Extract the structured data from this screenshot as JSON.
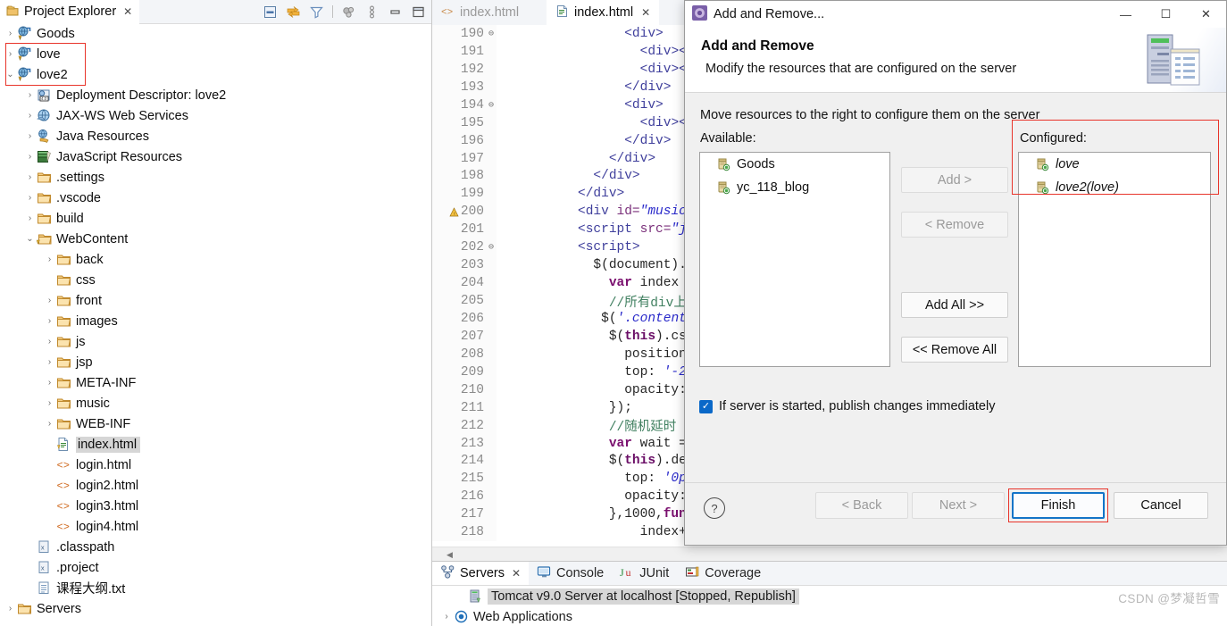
{
  "explorer": {
    "tab_title": "Project Explorer",
    "tab_close": "✕",
    "toolbar": [
      "collapse-all-icon",
      "link-with-editor-icon",
      "filter-icon",
      "view-menu-icon",
      "more-icon",
      "minimize-icon",
      "maximize-icon"
    ],
    "tree": [
      {
        "label": "Goods",
        "depth": 0,
        "twist": "›",
        "icon": "dynamic-web-project-icon"
      },
      {
        "label": "love",
        "depth": 0,
        "twist": "›",
        "icon": "dynamic-web-project-icon"
      },
      {
        "label": "love2",
        "depth": 0,
        "twist": "⌄",
        "icon": "dynamic-web-project-icon"
      },
      {
        "label": "Deployment Descriptor: love2",
        "depth": 1,
        "twist": "›",
        "icon": "deployment-descriptor-icon"
      },
      {
        "label": "JAX-WS Web Services",
        "depth": 1,
        "twist": "›",
        "icon": "jaxws-icon"
      },
      {
        "label": "Java Resources",
        "depth": 1,
        "twist": "›",
        "icon": "java-resources-icon"
      },
      {
        "label": "JavaScript Resources",
        "depth": 1,
        "twist": "›",
        "icon": "javascript-resources-icon"
      },
      {
        "label": ".settings",
        "depth": 1,
        "twist": "›",
        "icon": "folder-icon"
      },
      {
        "label": ".vscode",
        "depth": 1,
        "twist": "›",
        "icon": "folder-icon"
      },
      {
        "label": "build",
        "depth": 1,
        "twist": "›",
        "icon": "folder-icon"
      },
      {
        "label": "WebContent",
        "depth": 1,
        "twist": "⌄",
        "icon": "webcontent-folder-icon"
      },
      {
        "label": "back",
        "depth": 2,
        "twist": "›",
        "icon": "folder-icon"
      },
      {
        "label": "css",
        "depth": 2,
        "twist": "",
        "icon": "folder-icon"
      },
      {
        "label": "front",
        "depth": 2,
        "twist": "›",
        "icon": "folder-icon"
      },
      {
        "label": "images",
        "depth": 2,
        "twist": "›",
        "icon": "folder-icon"
      },
      {
        "label": "js",
        "depth": 2,
        "twist": "›",
        "icon": "folder-icon"
      },
      {
        "label": "jsp",
        "depth": 2,
        "twist": "›",
        "icon": "folder-icon"
      },
      {
        "label": "META-INF",
        "depth": 2,
        "twist": "›",
        "icon": "folder-icon"
      },
      {
        "label": "music",
        "depth": 2,
        "twist": "›",
        "icon": "folder-icon"
      },
      {
        "label": "WEB-INF",
        "depth": 2,
        "twist": "›",
        "icon": "folder-icon"
      },
      {
        "label": "index.html",
        "depth": 2,
        "twist": "",
        "icon": "html-warning-icon",
        "selected": true
      },
      {
        "label": "login.html",
        "depth": 2,
        "twist": "",
        "icon": "html-icon"
      },
      {
        "label": "login2.html",
        "depth": 2,
        "twist": "",
        "icon": "html-icon"
      },
      {
        "label": "login3.html",
        "depth": 2,
        "twist": "",
        "icon": "html-icon"
      },
      {
        "label": "login4.html",
        "depth": 2,
        "twist": "",
        "icon": "html-icon"
      },
      {
        "label": ".classpath",
        "depth": 1,
        "twist": "",
        "icon": "xml-file-icon"
      },
      {
        "label": ".project",
        "depth": 1,
        "twist": "",
        "icon": "xml-file-icon"
      },
      {
        "label": "课程大纲.txt",
        "depth": 1,
        "twist": "",
        "icon": "text-file-icon"
      },
      {
        "label": "Servers",
        "depth": 0,
        "twist": "›",
        "icon": "folder-icon"
      }
    ]
  },
  "editor": {
    "tabs": [
      {
        "label": "index.html",
        "icon": "code-icon",
        "active": false
      },
      {
        "label": "index.html",
        "icon": "html-file-icon",
        "active": true,
        "close": "✕"
      }
    ],
    "lines": [
      {
        "n": "190",
        "fold": "⊖",
        "warn": false,
        "html": "                <span class='tg'>&lt;div&gt;</span>"
      },
      {
        "n": "191",
        "fold": "",
        "warn": false,
        "html": "                  <span class='tg'>&lt;div&gt;&lt;</span>"
      },
      {
        "n": "192",
        "fold": "",
        "warn": false,
        "html": "                  <span class='tg'>&lt;div&gt;&lt;</span>"
      },
      {
        "n": "193",
        "fold": "",
        "warn": false,
        "html": "                <span class='tg'>&lt;/div&gt;</span>"
      },
      {
        "n": "194",
        "fold": "⊖",
        "warn": false,
        "html": "                <span class='tg'>&lt;div&gt;</span>"
      },
      {
        "n": "195",
        "fold": "",
        "warn": false,
        "html": "                  <span class='tg'>&lt;div&gt;&lt;</span>"
      },
      {
        "n": "196",
        "fold": "",
        "warn": false,
        "html": "                <span class='tg'>&lt;/div&gt;</span>"
      },
      {
        "n": "197",
        "fold": "",
        "warn": false,
        "html": "              <span class='tg'>&lt;/div&gt;</span>"
      },
      {
        "n": "198",
        "fold": "",
        "warn": false,
        "html": "            <span class='tg'>&lt;/div&gt;</span>"
      },
      {
        "n": "199",
        "fold": "",
        "warn": false,
        "html": "          <span class='tg'>&lt;/div&gt;</span>"
      },
      {
        "n": "200",
        "fold": "",
        "warn": true,
        "html": "          <span class='tg'>&lt;div</span> <span class='at'>id=</span><span class='st'>\"music\"</span><span class='tg'>&gt;&lt;a</span>"
      },
      {
        "n": "201",
        "fold": "",
        "warn": false,
        "html": "          <span class='tg'>&lt;script</span> <span class='at'>src=</span><span class='st'>\"js/jq</span>"
      },
      {
        "n": "202",
        "fold": "⊖",
        "warn": false,
        "html": "          <span class='tg'>&lt;script&gt;</span>"
      },
      {
        "n": "203",
        "fold": "",
        "warn": false,
        "html": "            $(document).re"
      },
      {
        "n": "204",
        "fold": "",
        "warn": false,
        "html": "              <span class='kw'>var</span> index"
      },
      {
        "n": "205",
        "fold": "",
        "warn": false,
        "html": "              <span class='cm'>//所有div上</span>"
      },
      {
        "n": "206",
        "fold": "",
        "warn": false,
        "html": "             $(<span class='st'>'.content</span>"
      },
      {
        "n": "207",
        "fold": "",
        "warn": false,
        "html": "              $(<span class='fn'>this</span>).cs"
      },
      {
        "n": "208",
        "fold": "",
        "warn": false,
        "html": "                position"
      },
      {
        "n": "209",
        "fold": "",
        "warn": false,
        "html": "                top: <span class='st'>'-2</span>"
      },
      {
        "n": "210",
        "fold": "",
        "warn": false,
        "html": "                opacity:"
      },
      {
        "n": "211",
        "fold": "",
        "warn": false,
        "html": "              });"
      },
      {
        "n": "212",
        "fold": "",
        "warn": false,
        "html": "              <span class='cm'>//随机延时</span>"
      },
      {
        "n": "213",
        "fold": "",
        "warn": false,
        "html": "              <span class='kw'>var</span> wait ="
      },
      {
        "n": "214",
        "fold": "",
        "warn": false,
        "html": "              $(<span class='fn'>this</span>).de"
      },
      {
        "n": "215",
        "fold": "",
        "warn": false,
        "html": "                top: <span class='st'>'0p</span>"
      },
      {
        "n": "216",
        "fold": "",
        "warn": false,
        "html": "                opacity:"
      },
      {
        "n": "217",
        "fold": "",
        "warn": false,
        "html": "              },1000,<span class='kw'>fun</span>"
      },
      {
        "n": "218",
        "fold": "",
        "warn": false,
        "html": "                  index+"
      }
    ]
  },
  "bottom_panel": {
    "tabs": [
      {
        "label": "Servers",
        "icon": "servers-icon",
        "active": true,
        "close": "✕"
      },
      {
        "label": "Console",
        "icon": "console-icon",
        "active": false
      },
      {
        "label": "JUnit",
        "icon": "junit-icon",
        "active": false
      },
      {
        "label": "Coverage",
        "icon": "coverage-icon",
        "active": false
      }
    ],
    "rows": [
      {
        "label": "Tomcat v9.0 Server at localhost  [Stopped, Republish]",
        "icon": "server-icon",
        "twist": "",
        "selected": true,
        "depth": 1
      },
      {
        "label": "Web Applications",
        "icon": "web-applications-icon",
        "twist": "›",
        "selected": false,
        "depth": 0
      }
    ]
  },
  "dialog": {
    "window_title": "Add and Remove...",
    "window_icon": "gear-icon",
    "minimize": "—",
    "maximize": "☐",
    "close": "✕",
    "heading": "Add and Remove",
    "subheading": "Modify the resources that are configured on the server",
    "hint": "Move resources to the right to configure them on the server",
    "available_label": "Available:",
    "configured_label": "Configured:",
    "available_items": [
      {
        "label": "Goods",
        "icon": "module-icon"
      },
      {
        "label": "yc_118_blog",
        "icon": "module-icon"
      }
    ],
    "configured_items": [
      {
        "label": "love",
        "icon": "module-icon"
      },
      {
        "label": "love2(love)",
        "icon": "module-icon"
      }
    ],
    "buttons": {
      "add": "Add >",
      "remove": "< Remove",
      "add_all": "Add All >>",
      "remove_all": "<< Remove All"
    },
    "checkbox": {
      "label": "If server is started, publish changes immediately",
      "checked": true,
      "check_glyph": "✓"
    },
    "footer": {
      "help": "?",
      "back": "< Back",
      "next": "Next >",
      "finish": "Finish",
      "cancel": "Cancel"
    }
  },
  "watermark": "CSDN @梦凝哲雪",
  "colors": {
    "accent": "#0a68c8",
    "highlight_red": "#e8342a",
    "dialog_bg": "#f0f0f0",
    "selection": "#d6d6d6"
  }
}
